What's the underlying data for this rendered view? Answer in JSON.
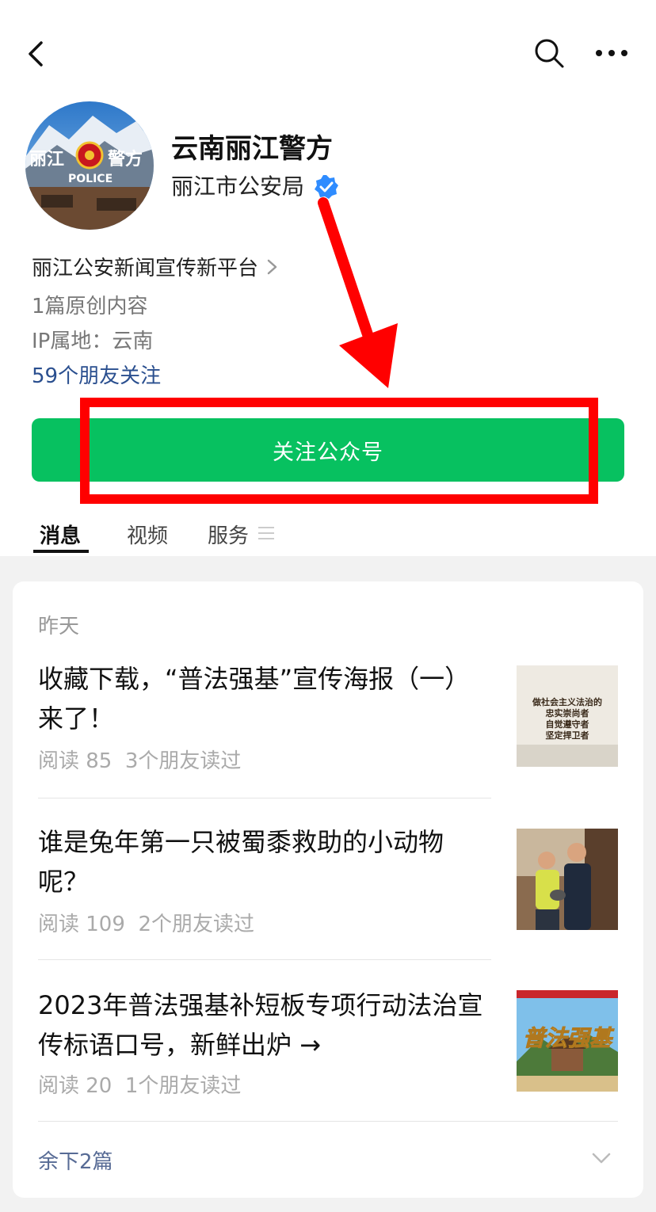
{
  "account": {
    "name": "云南丽江警方",
    "org": "丽江市公安局",
    "avatar_text_left": "丽江",
    "avatar_text_right": "警方",
    "avatar_text_sub": "POLICE"
  },
  "profile": {
    "bio": "丽江公安新闻宣传新平台",
    "original_count": "1篇原创内容",
    "ip_location": "IP属地：云南",
    "friends_follow": "59个朋友关注"
  },
  "follow_button": {
    "label": "关注公众号"
  },
  "tabs": [
    {
      "label": "消息",
      "active": true
    },
    {
      "label": "视频",
      "active": false
    },
    {
      "label": "服务",
      "active": false
    }
  ],
  "feed": {
    "date_label": "昨天",
    "articles": [
      {
        "title": "收藏下载，“普法强基”宣传海报（一）来了！",
        "reads": "阅读 85",
        "friends_read": "3个朋友读过",
        "thumb_lines": [
          "做社会主义法治的",
          "忠实崇尚者",
          "自觉遵守者",
          "坚定捍卫者"
        ]
      },
      {
        "title": "谁是兔年第一只被蜀黍救助的小动物呢？",
        "reads": "阅读 109",
        "friends_read": "2个朋友读过"
      },
      {
        "title": "2023年普法强基补短板专项行动法治宣传标语口号，新鲜出炉 →",
        "reads": "阅读 20",
        "friends_read": "1个朋友读过",
        "thumb_text": "普法强基"
      }
    ],
    "remaining": "余下2篇"
  },
  "colors": {
    "accent_green": "#07c160",
    "link_blue": "#2a4f8f",
    "annotation_red": "#ff0000"
  }
}
